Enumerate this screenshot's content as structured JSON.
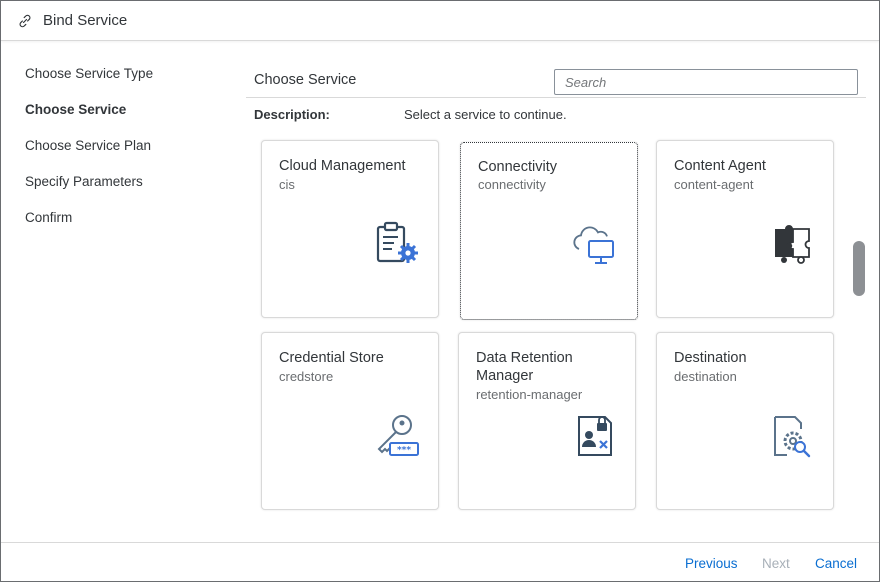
{
  "dialog": {
    "title": "Bind Service"
  },
  "steps": [
    {
      "label": "Choose Service Type",
      "active": false
    },
    {
      "label": "Choose Service",
      "active": true
    },
    {
      "label": "Choose Service Plan",
      "active": false
    },
    {
      "label": "Specify Parameters",
      "active": false
    },
    {
      "label": "Confirm",
      "active": false
    }
  ],
  "main": {
    "title": "Choose Service",
    "search_placeholder": "Search",
    "description_label": "Description:",
    "description_text": "Select a service to continue."
  },
  "services": [
    {
      "name": "Cloud Management",
      "id": "cis",
      "icon": "clipboard-gear-icon"
    },
    {
      "name": "Connectivity",
      "id": "connectivity",
      "icon": "cloud-monitor-icon"
    },
    {
      "name": "Content Agent",
      "id": "content-agent",
      "icon": "puzzle-icon"
    },
    {
      "name": "Credential Store",
      "id": "credstore",
      "icon": "key-password-icon"
    },
    {
      "name": "Data Retention Manager",
      "id": "retention-manager",
      "icon": "document-user-lock-icon"
    },
    {
      "name": "Destination",
      "id": "destination",
      "icon": "document-gear-search-icon"
    }
  ],
  "footer": {
    "previous": "Previous",
    "next": "Next",
    "cancel": "Cancel"
  },
  "colors": {
    "accent": "#0a6ed1",
    "icon_dark": "#354a5f",
    "icon_blue": "#3b73d6",
    "icon_light": "#5b738b"
  }
}
